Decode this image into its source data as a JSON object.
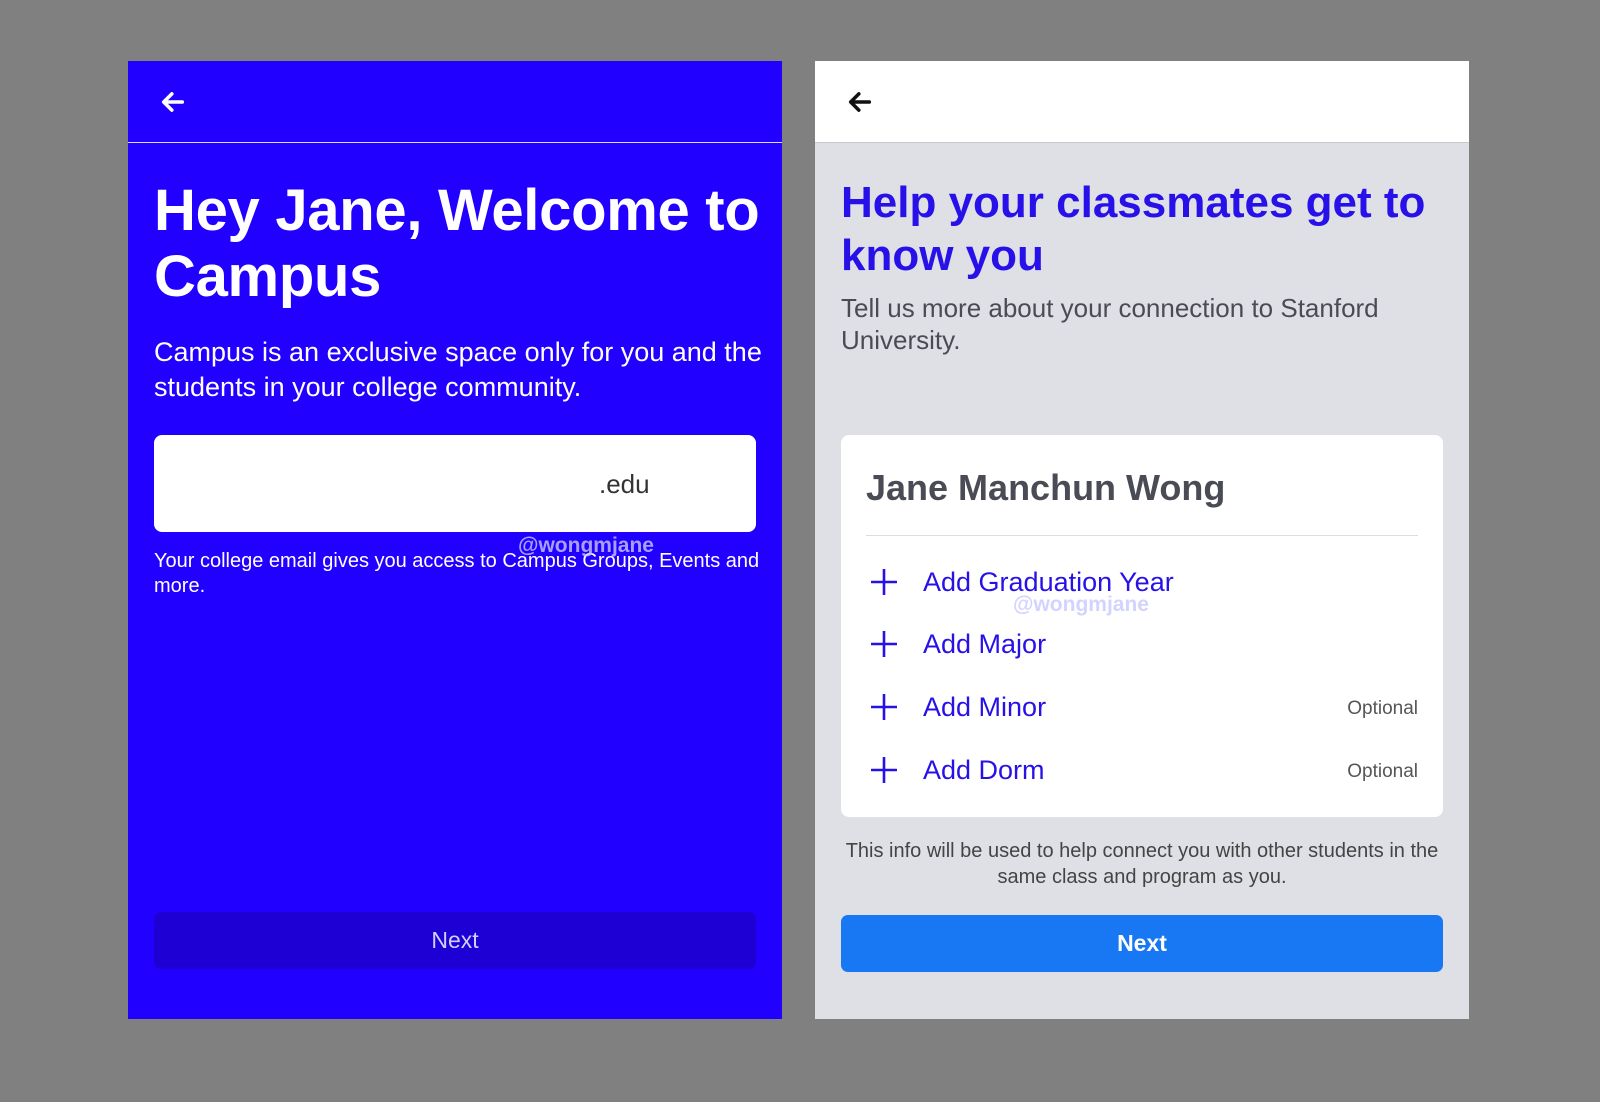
{
  "colors": {
    "page_background": "#808080",
    "left_background": "#2200ff",
    "left_next_button": "#1e00d4",
    "right_background": "#dfe0e6",
    "right_accent": "#2710e8",
    "right_next_button": "#1877f2"
  },
  "left": {
    "back_icon": "back-arrow-icon",
    "title": "Hey Jane, Welcome to Campus",
    "description": "Campus is an exclusive space only for you and the students in your college community.",
    "email": {
      "value": "",
      "suffix": ".edu"
    },
    "hint": "Your college email gives you access to Campus Groups, Events and more.",
    "watermark": "@wongmjane",
    "next_label": "Next"
  },
  "right": {
    "back_icon": "back-arrow-icon",
    "title": "Help your classmates get to know you",
    "subtitle": "Tell us more about your connection to Stanford University.",
    "card": {
      "name": "Jane Manchun Wong",
      "fields": [
        {
          "label": "Add Graduation Year",
          "optional": ""
        },
        {
          "label": "Add Major",
          "optional": ""
        },
        {
          "label": "Add Minor",
          "optional": "Optional"
        },
        {
          "label": "Add Dorm",
          "optional": "Optional"
        }
      ],
      "watermark": "@wongmjane"
    },
    "footnote": "This info will be used to help connect you with other students in the same class and program as you.",
    "next_label": "Next"
  }
}
